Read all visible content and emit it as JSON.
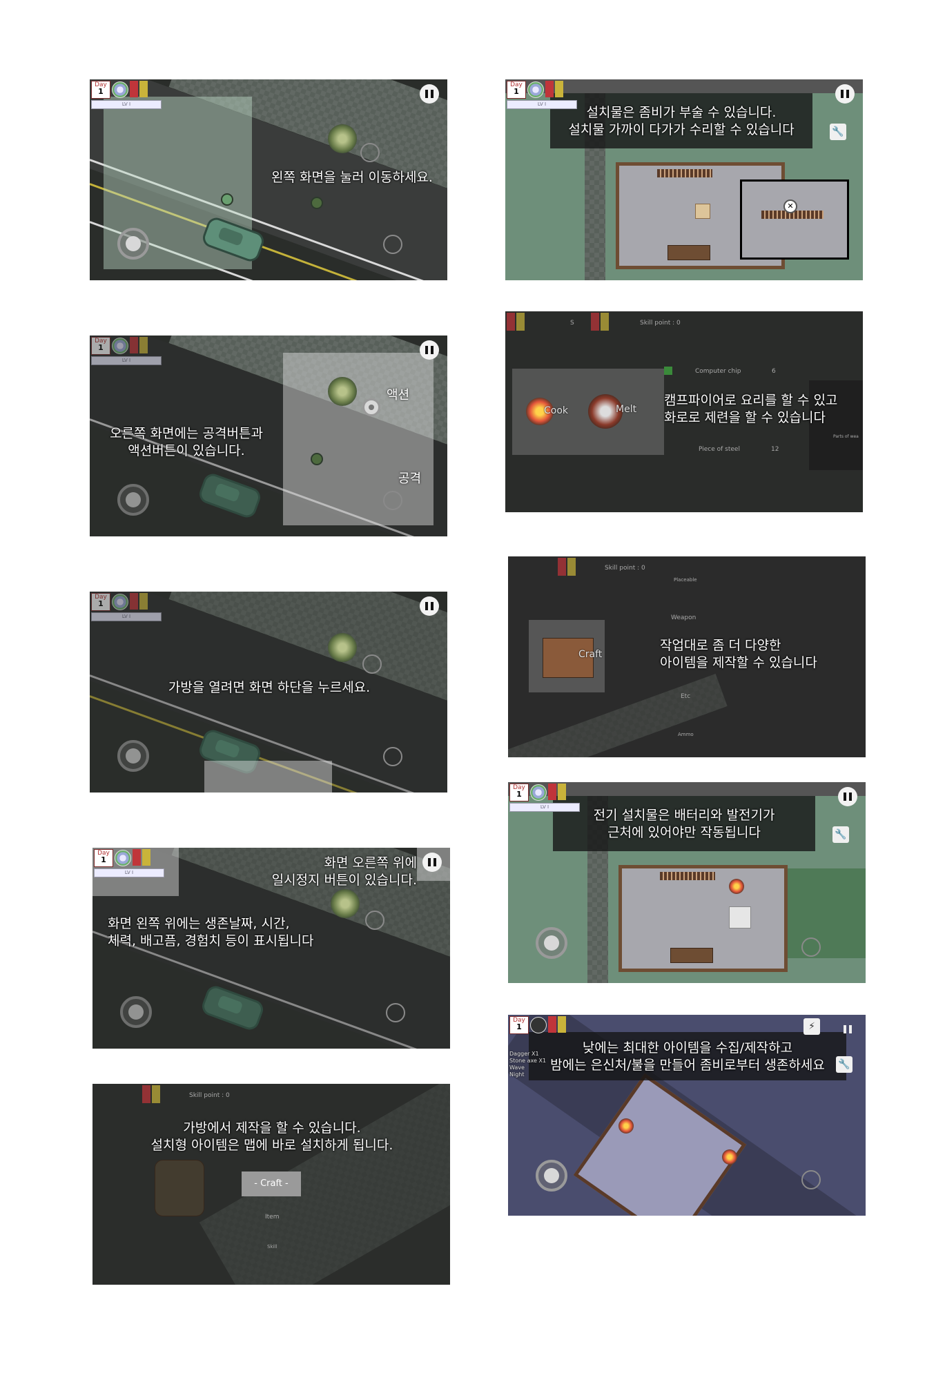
{
  "hud": {
    "day_label": "Day",
    "day_value": "1",
    "level_label": "LV I"
  },
  "panels": {
    "p1": {
      "caption": "왼쪽 화면을 눌러 이동하세요."
    },
    "p2": {
      "caption": "오른쪽 화면에는 공격버튼과\n액션버튼이 있습니다.",
      "action_label": "액션",
      "attack_label": "공격"
    },
    "p3": {
      "caption": "가방을 열려면 화면 하단을 누르세요."
    },
    "p4": {
      "caption_top": "화면 오른쪽 위에\n일시정지 버튼이 있습니다.",
      "caption_bottom": "화면 왼쪽 위에는 생존날짜, 시간,\n체력, 배고픔, 경험치 등이 표시됩니다"
    },
    "p5": {
      "caption": "가방에서 제작을 할 수 있습니다.\n설치형 아이템은 맵에 바로 설치하게 됩니다.",
      "skill_point": "Skill point : 0",
      "craft_button": "- Craft -",
      "item_label": "Item",
      "skill_label": "Skill"
    },
    "p6": {
      "caption": "설치물은 좀비가 부술 수 있습니다.\n설치물 가까이 다가가 수리할 수 있습니다"
    },
    "p7": {
      "caption": "캠프파이어로 요리를 할 수 있고\n화로로 제련을 할 수 있습니다",
      "skill_point": "Skill point : 0",
      "cook_label": "Cook",
      "melt_label": "Melt",
      "computer_chip": "Computer chip",
      "computer_chip_qty": "6",
      "piece_of_steel": "Piece of steel",
      "piece_of_steel_qty": "12",
      "parts_label": "Parts of wea",
      "s_label": "S"
    },
    "p8": {
      "caption": "작업대로 좀 더 다양한\n아이템을 제작할 수 있습니다",
      "skill_point": "Skill point : 0",
      "craft_label": "Craft",
      "placeable": "Placeable",
      "weapon": "Weapon",
      "etc": "Etc",
      "ammo": "Ammo"
    },
    "p9": {
      "caption": "전기 설치물은 배터리와 발전기가\n근처에 있어야만 작동됩니다"
    },
    "p10": {
      "caption": "낮에는 최대한 아이템을 수집/제작하고\n밤에는 은신처/불을 만들어 좀비로부터 생존하세요",
      "side_list": "Dagger X1\nStone axe X1\nWave\nNight"
    }
  }
}
